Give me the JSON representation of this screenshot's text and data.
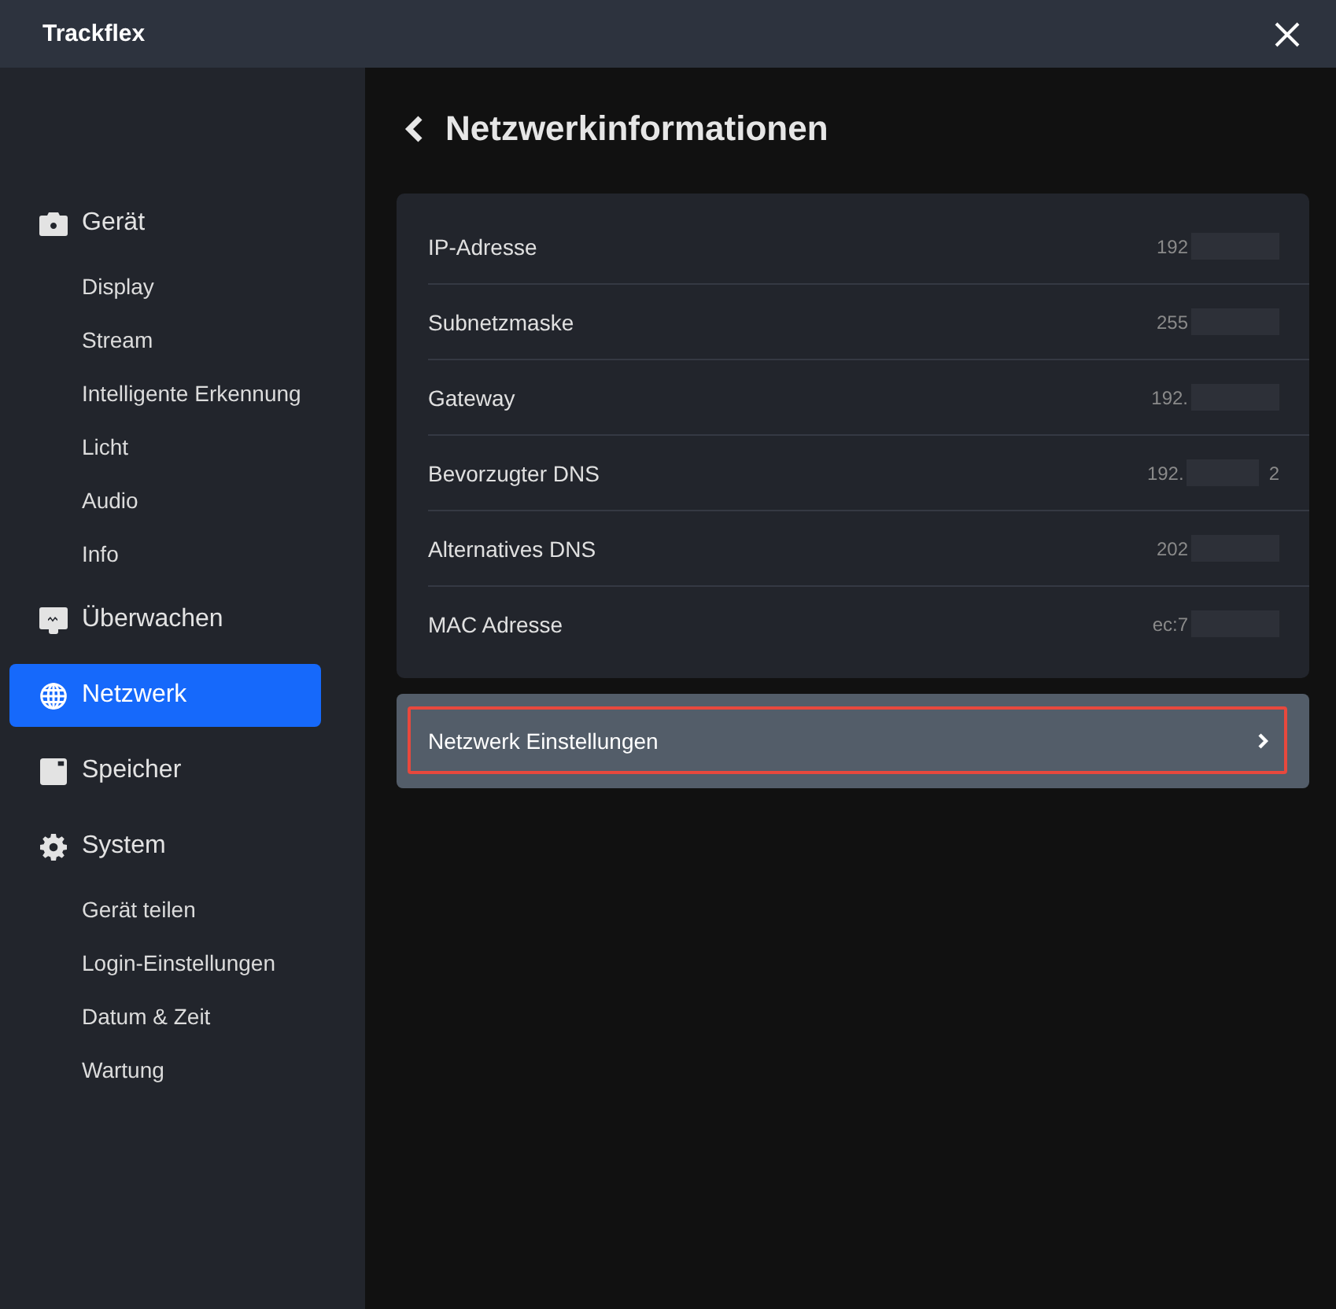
{
  "window": {
    "title": "Trackflex"
  },
  "sidebar": {
    "items": [
      {
        "label": "Gerät",
        "selected": false,
        "children": [
          {
            "label": "Display",
            "selected": false
          },
          {
            "label": "Stream",
            "selected": false
          },
          {
            "label": "Intelligente Erkennung",
            "selected": false
          },
          {
            "label": "Licht",
            "selected": false
          },
          {
            "label": "Audio",
            "selected": false
          },
          {
            "label": "Info",
            "selected": false
          }
        ]
      },
      {
        "label": "Überwachen",
        "selected": false
      },
      {
        "label": "Netzwerk",
        "selected": true
      },
      {
        "label": "Speicher",
        "selected": false
      },
      {
        "label": "System",
        "selected": false,
        "children": [
          {
            "label": "Gerät teilen",
            "selected": false
          },
          {
            "label": "Login-Einstellungen",
            "selected": false
          },
          {
            "label": "Datum & Zeit",
            "selected": false
          },
          {
            "label": "Wartung",
            "selected": false
          }
        ]
      }
    ]
  },
  "page": {
    "title": "Netzwerkinformationen"
  },
  "info_rows": [
    {
      "label": "IP-Adresse",
      "value": "192",
      "redacted": true
    },
    {
      "label": "Subnetzmaske",
      "value": "255",
      "redacted": true
    },
    {
      "label": "Gateway",
      "value": "192.",
      "redacted": true
    },
    {
      "label": "Bevorzugter DNS",
      "value": "192.",
      "redacted": true,
      "value_tail": "2"
    },
    {
      "label": "Alternatives DNS",
      "value": "202",
      "redacted": true
    },
    {
      "label": "MAC Adresse",
      "value": "ec:7",
      "redacted": true
    }
  ],
  "settings_link": {
    "label": "Netzwerk Einstellungen",
    "highlighted": true
  }
}
